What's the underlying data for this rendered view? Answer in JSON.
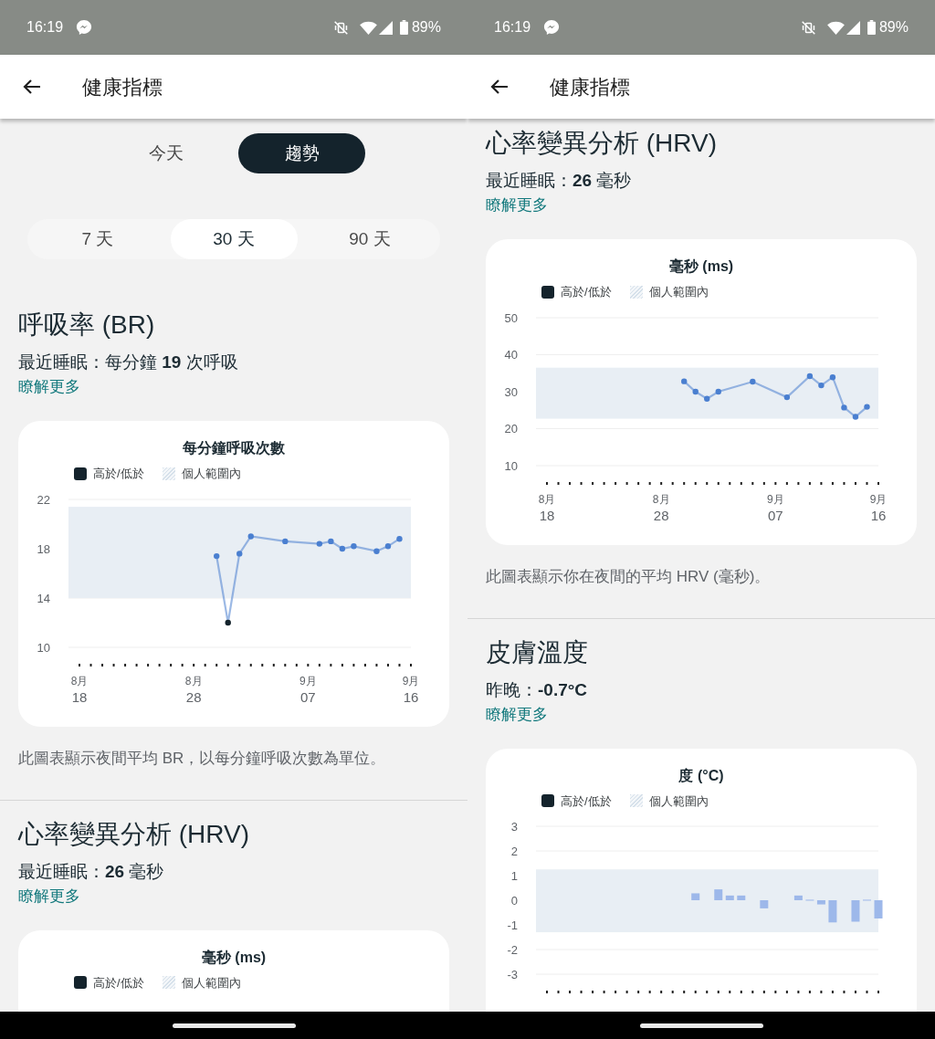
{
  "screens": [
    {
      "status_bar": {
        "time": "16:19",
        "battery": "89%"
      },
      "app_bar": {
        "title": "健康指標"
      },
      "view_toggle": [
        {
          "label": "今天",
          "selected": false
        },
        {
          "label": "趨勢",
          "selected": true
        }
      ],
      "range_tabs": [
        {
          "label": "7 天",
          "selected": false
        },
        {
          "label": "30 天",
          "selected": true
        },
        {
          "label": "90 天",
          "selected": false
        }
      ],
      "sections": [
        {
          "title": "呼吸率 (BR)",
          "summary": "最近睡眠：每分鐘 **19** 次呼吸",
          "link": "瞭解更多",
          "chart": {
            "legend": [
              {
                "label": "高於/低於",
                "kind": "solid"
              },
              {
                "label": "個人範圍內",
                "kind": "hatched"
              }
            ],
            "chart_data": {
              "type": "line",
              "title": "每分鐘呼吸次數",
              "categories": [
                "8月\n18",
                null,
                null,
                null,
                null,
                null,
                null,
                null,
                null,
                null,
                "8月\n28",
                null,
                null,
                null,
                null,
                null,
                null,
                null,
                null,
                null,
                "9月\n07",
                null,
                null,
                null,
                null,
                null,
                null,
                null,
                null,
                "9月\n16"
              ],
              "series": [
                {
                  "color": "#4a7fd0",
                  "marker": "o",
                  "values": [
                    null,
                    null,
                    null,
                    null,
                    null,
                    null,
                    null,
                    null,
                    null,
                    null,
                    null,
                    null,
                    17.4,
                    12,
                    17.6,
                    19,
                    null,
                    null,
                    18.6,
                    null,
                    null,
                    18.4,
                    18.6,
                    18,
                    18.2,
                    null,
                    17.8,
                    18.2,
                    18.8,
                    null
                  ]
                }
              ],
              "ylim": [
                10,
                22
              ],
              "yticks": [
                10,
                14,
                18,
                22
              ],
              "grid": true,
              "bands": [
                {
                  "axis": "y",
                  "from": 14,
                  "to": 21.4,
                  "color": "#e8eef4"
                }
              ]
            }
          },
          "caption": "此圖表顯示夜間平均 BR，以每分鐘呼吸次數為單位。"
        },
        {
          "title": "心率變異分析 (HRV)",
          "summary": "最近睡眠：**26** 毫秒",
          "link": "瞭解更多",
          "chart": {
            "title": "毫秒 (ms)",
            "legend": [
              {
                "label": "高於/低於",
                "kind": "solid"
              },
              {
                "label": "個人範圍內",
                "kind": "hatched"
              }
            ]
          }
        }
      ]
    },
    {
      "status_bar": {
        "time": "16:19",
        "battery": "89%"
      },
      "app_bar": {
        "title": "健康指標"
      },
      "sections": [
        {
          "title": "心率變異分析 (HRV)",
          "summary": "最近睡眠：**26** 毫秒",
          "link": "瞭解更多",
          "chart": {
            "legend": [
              {
                "label": "高於/低於",
                "kind": "solid"
              },
              {
                "label": "個人範圍內",
                "kind": "hatched"
              }
            ],
            "chart_data": {
              "type": "line",
              "title": "毫秒 (ms)",
              "categories": [
                "8月\n18",
                null,
                null,
                null,
                null,
                null,
                null,
                null,
                null,
                null,
                "8月\n28",
                null,
                null,
                null,
                null,
                null,
                null,
                null,
                null,
                null,
                "9月\n07",
                null,
                null,
                null,
                null,
                null,
                null,
                null,
                null,
                "9月\n16"
              ],
              "series": [
                {
                  "color": "#4a7fd0",
                  "marker": "o",
                  "values": [
                    null,
                    null,
                    null,
                    null,
                    null,
                    null,
                    null,
                    null,
                    null,
                    null,
                    null,
                    null,
                    32.8,
                    30,
                    28.1,
                    30,
                    null,
                    null,
                    32.7,
                    null,
                    null,
                    28.5,
                    null,
                    34.2,
                    31.7,
                    33.9,
                    25.7,
                    23.2,
                    25.9,
                    null
                  ]
                }
              ],
              "ylim": [
                10,
                50
              ],
              "yticks": [
                10,
                20,
                30,
                40,
                50
              ],
              "grid": true,
              "bands": [
                {
                  "axis": "y",
                  "from": 22.7,
                  "to": 36.5,
                  "color": "#e8eef4"
                }
              ]
            }
          },
          "caption": "此圖表顯示你在夜間的平均 HRV (毫秒)。"
        },
        {
          "title": "皮膚溫度",
          "summary": "昨晚：**-0.7°C**",
          "link": "瞭解更多",
          "chart": {
            "legend": [
              {
                "label": "高於/低於",
                "kind": "solid"
              },
              {
                "label": "個人範圍內",
                "kind": "hatched"
              }
            ],
            "chart_data": {
              "type": "bar",
              "title": "度 (°C)",
              "categories": [
                null,
                null,
                null,
                null,
                null,
                null,
                null,
                null,
                null,
                null,
                null,
                null,
                null,
                null,
                null,
                null,
                null,
                null,
                null,
                null,
                null,
                null,
                null,
                null,
                null,
                null,
                null,
                null,
                null,
                null
              ],
              "series": [
                {
                  "color": "#9db8ea",
                  "values": [
                    null,
                    null,
                    null,
                    null,
                    null,
                    null,
                    null,
                    null,
                    null,
                    null,
                    null,
                    null,
                    null,
                    0.28,
                    null,
                    0.44,
                    0.19,
                    0.19,
                    null,
                    -0.33,
                    null,
                    null,
                    0.19,
                    0.02,
                    -0.17,
                    -0.9,
                    null,
                    -0.87,
                    0.02,
                    -0.74
                  ]
                }
              ],
              "ylim": [
                -3,
                3
              ],
              "yticks": [
                -3,
                -2,
                -1,
                0,
                1,
                2,
                3
              ],
              "grid": true,
              "bands": [
                {
                  "axis": "y",
                  "from": -1.3,
                  "to": 1.25,
                  "color": "#e8eef4"
                }
              ]
            }
          }
        }
      ]
    }
  ]
}
